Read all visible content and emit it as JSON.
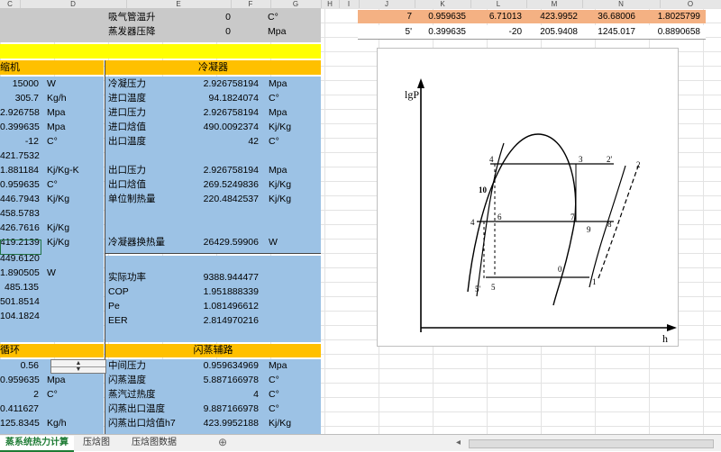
{
  "col_headers": [
    "C",
    "D",
    "E",
    "F",
    "G",
    "H",
    "I",
    "J",
    "K",
    "L",
    "M",
    "N",
    "O"
  ],
  "top_rows": [
    {
      "label": "吸气管温升",
      "value": "0",
      "unit": "C°"
    },
    {
      "label": "蒸发器压降",
      "value": "0",
      "unit": "Mpa"
    }
  ],
  "right_rows": [
    {
      "values": [
        "7",
        "0.959635",
        "6.71013",
        "423.9952",
        "36.68006",
        "1.8025799"
      ]
    },
    {
      "values": [
        "5'",
        "0.399635",
        "-20",
        "205.9408",
        "1245.017",
        "0.8890658"
      ]
    }
  ],
  "headers": {
    "compressor": "缩机",
    "condenser": "冷凝器",
    "cycle": "循环",
    "flash": "闪蒸辅路"
  },
  "left_col": [
    {
      "value": "15000",
      "unit": "W"
    },
    {
      "value": "305.7",
      "unit": "Kg/h"
    },
    {
      "value": "2.926758",
      "unit": "Mpa"
    },
    {
      "value": "0.399635",
      "unit": "Mpa"
    },
    {
      "value": "-12",
      "unit": "C°"
    },
    {
      "value": "421.7532",
      "unit": ""
    },
    {
      "value": "1.881184",
      "unit": "Kj/Kg-K"
    },
    {
      "value": "0.959635",
      "unit": "C°"
    },
    {
      "value": "446.7943",
      "unit": "Kj/Kg"
    },
    {
      "value": "458.5783",
      "unit": ""
    },
    {
      "value": "426.7616",
      "unit": "Kj/Kg"
    },
    {
      "value": "419.2139",
      "unit": "Kj/Kg"
    },
    {
      "value": "449.6120",
      "unit": ""
    },
    {
      "value": "1.890505",
      "unit": "W"
    },
    {
      "value": "485.135",
      "unit": ""
    },
    {
      "value": "501.8514",
      "unit": ""
    },
    {
      "value": "104.1824",
      "unit": ""
    }
  ],
  "condenser_rows": [
    {
      "label": "冷凝压力",
      "value": "2.926758194",
      "unit": "Mpa"
    },
    {
      "label": "进口温度",
      "value": "94.1824074",
      "unit": "C°"
    },
    {
      "label": "进口压力",
      "value": "2.926758194",
      "unit": "Mpa"
    },
    {
      "label": "进口焓值",
      "value": "490.0092374",
      "unit": "Kj/Kg"
    },
    {
      "label": "出口温度",
      "value": "42",
      "unit": "C°"
    },
    {
      "label": "出口压力",
      "value": "2.926758194",
      "unit": "Mpa"
    },
    {
      "label": "出口焓值",
      "value": "269.5249836",
      "unit": "Kj/Kg"
    },
    {
      "label": "单位制热量",
      "value": "220.4842537",
      "unit": "Kj/Kg"
    },
    {
      "label": "冷凝器换热量",
      "value": "26429.59906",
      "unit": "W"
    }
  ],
  "perf_rows": [
    {
      "label": "实际功率",
      "value": "9388.944477"
    },
    {
      "label": "COP",
      "value": "1.951888339"
    },
    {
      "label": "Pe",
      "value": "1.081496612"
    },
    {
      "label": "EER",
      "value": "2.814970216"
    }
  ],
  "cycle_rows": [
    {
      "value": "0.56",
      "unit": ""
    },
    {
      "value": "0.959635",
      "unit": "Mpa"
    },
    {
      "value": "2",
      "unit": "C°"
    },
    {
      "value": "0.411627",
      "unit": ""
    },
    {
      "value": "125.8345",
      "unit": "Kg/h"
    }
  ],
  "flash_rows": [
    {
      "label": "中间压力",
      "value": "0.959634969",
      "unit": "Mpa"
    },
    {
      "label": "闪蒸温度",
      "value": "5.887166978",
      "unit": "C°"
    },
    {
      "label": "蒸汽过热度",
      "value": "4",
      "unit": "C°"
    },
    {
      "label": "闪蒸出口温度",
      "value": "9.887166978",
      "unit": "C°"
    },
    {
      "label": "闪蒸出口焓值h7",
      "value": "423.9952188",
      "unit": "Kj/Kg"
    }
  ],
  "diagram": {
    "y_axis_label": "lgP",
    "x_axis_label": "h",
    "points": [
      "1",
      "2",
      "2'",
      "3",
      "4",
      "4",
      "5",
      "5'",
      "6",
      "7",
      "8",
      "9",
      "0",
      "10"
    ]
  },
  "tabs": [
    "蒸系统热力计算",
    "压焓图",
    "压焓图数据"
  ],
  "colors": {
    "blue": "#9cc2e5",
    "yellow": "#ffff00",
    "orange": "#ffc000",
    "salmon": "#f4b183",
    "gray": "#c9c9c9"
  }
}
